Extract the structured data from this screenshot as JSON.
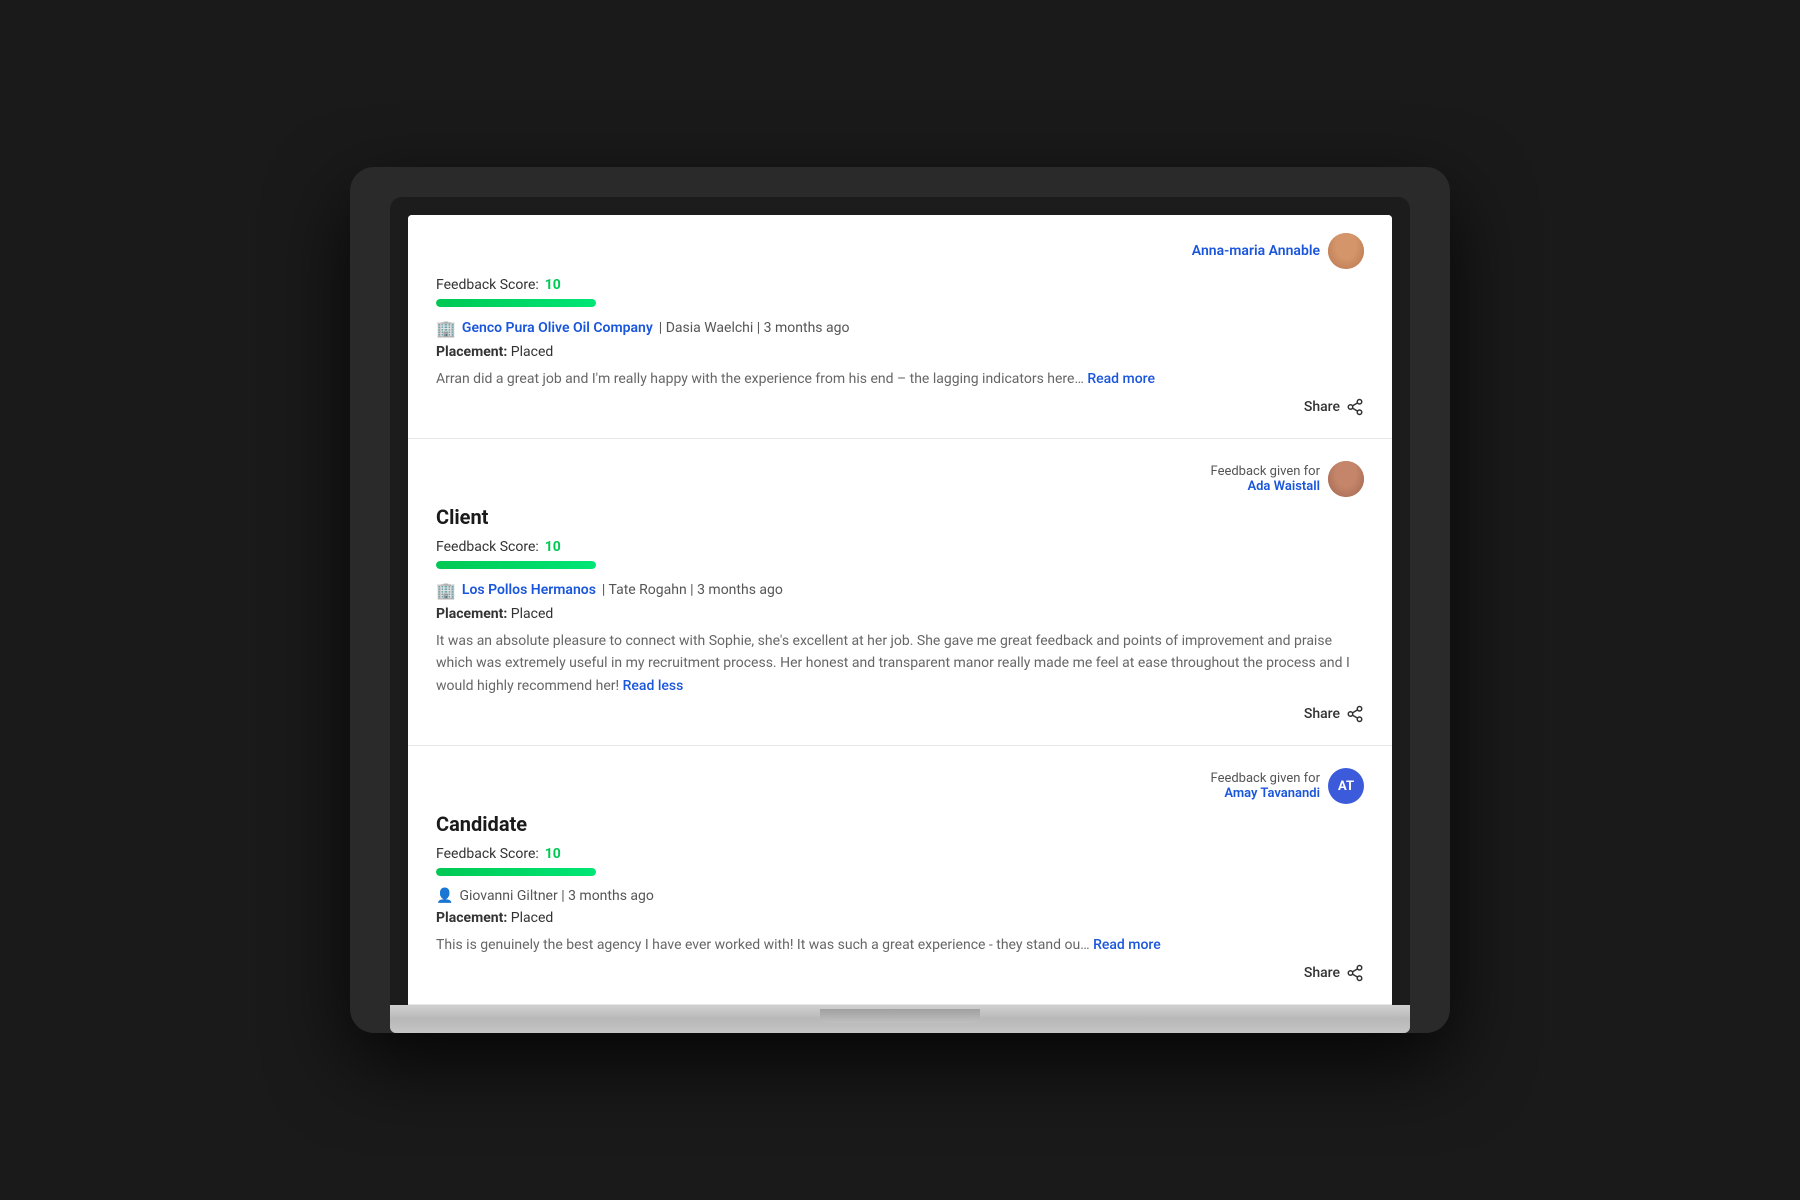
{
  "cards": [
    {
      "id": "card-1",
      "type": null,
      "feedbackGivenFor": {
        "label": "",
        "name": "Anna-maria Annable",
        "avatarType": "photo",
        "initials": "AA"
      },
      "feedbackScore": {
        "label": "Feedback Score:",
        "value": "10"
      },
      "progressPercent": 100,
      "company": {
        "name": "Genco Pura Olive Oil Company",
        "meta": "| Dasia Waelchi | 3 months ago"
      },
      "placement": {
        "label": "Placement:",
        "value": "Placed"
      },
      "reviewText": "Arran did a great job and I'm really happy with the experience from his end – the lagging indicators here…",
      "readMoreLabel": "Read more",
      "shareLabel": "Share"
    },
    {
      "id": "card-2",
      "type": "Client",
      "feedbackGivenFor": {
        "label": "Feedback given for",
        "name": "Ada Waistall",
        "avatarType": "photo",
        "initials": "AW"
      },
      "feedbackScore": {
        "label": "Feedback Score:",
        "value": "10"
      },
      "progressPercent": 100,
      "company": {
        "name": "Los Pollos Hermanos",
        "meta": "| Tate Rogahn | 3 months ago"
      },
      "placement": {
        "label": "Placement:",
        "value": "Placed"
      },
      "reviewText": "It was an absolute pleasure to connect with Sophie, she's excellent at her job. She gave me great feedback and points of improvement and praise which was extremely useful in my recruitment process. Her honest and transparent manor really made me feel at ease throughout the process and I would highly recommend her!",
      "readMoreLabel": "Read less",
      "shareLabel": "Share"
    },
    {
      "id": "card-3",
      "type": "Candidate",
      "feedbackGivenFor": {
        "label": "Feedback given for",
        "name": "Amay Tavanandi",
        "avatarType": "initials",
        "initials": "AT"
      },
      "feedbackScore": {
        "label": "Feedback Score:",
        "value": "10"
      },
      "progressPercent": 100,
      "person": {
        "name": "Giovanni Giltner | 3 months ago"
      },
      "placement": {
        "label": "Placement:",
        "value": "Placed"
      },
      "reviewText": "This is genuinely the best agency I have ever worked with! It was such a great experience - they stand ou…",
      "readMoreLabel": "Read more",
      "shareLabel": "Share"
    }
  ]
}
